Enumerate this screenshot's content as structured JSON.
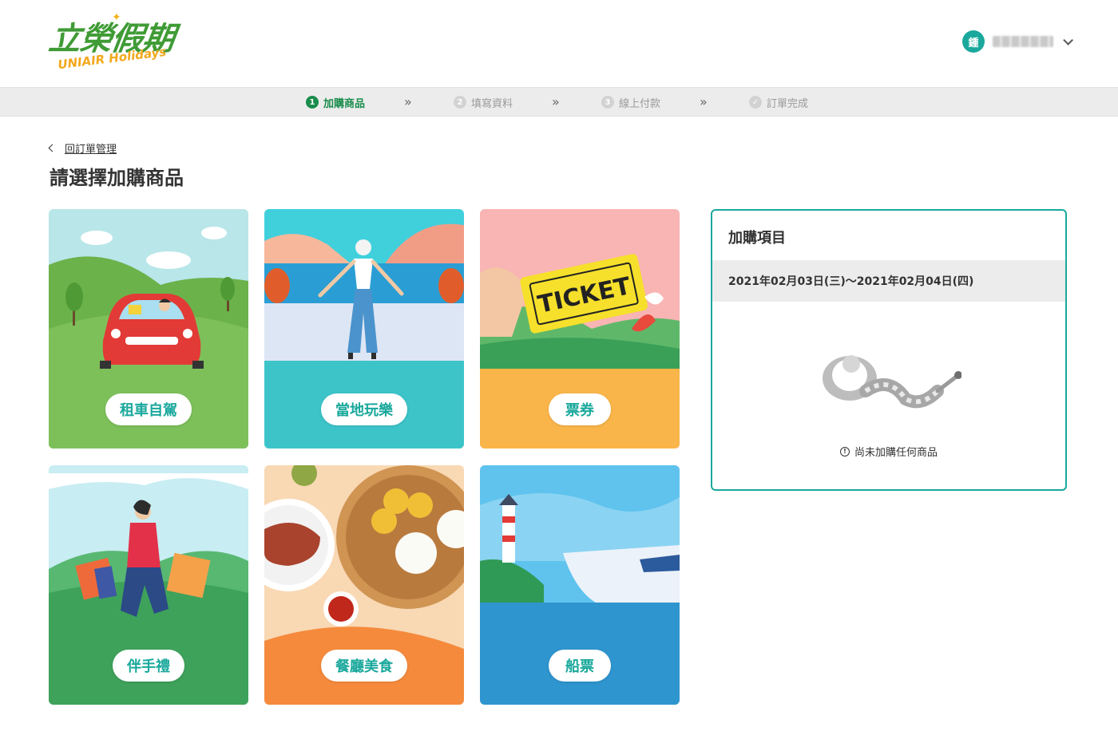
{
  "brand": {
    "name_cn": "立榮假期",
    "name_en": "UNIAIR Holidays",
    "colors": {
      "primary_green": "#3f9b35",
      "accent_orange": "#f2a81d",
      "teal": "#1aa89c"
    }
  },
  "user": {
    "avatar_initial": "鍾",
    "dropdown_icon": "chevron-down-icon"
  },
  "stepper": {
    "steps": [
      {
        "num": "1",
        "label": "加購商品",
        "active": true
      },
      {
        "num": "2",
        "label": "填寫資料",
        "active": false
      },
      {
        "num": "3",
        "label": "線上付款",
        "active": false
      },
      {
        "num": "✓",
        "label": "訂單完成",
        "active": false
      }
    ],
    "separator": "»"
  },
  "nav": {
    "back_label": "回訂單管理"
  },
  "page": {
    "title": "請選擇加購商品"
  },
  "categories": [
    {
      "label": "租車自駕",
      "illustration": "car-icon"
    },
    {
      "label": "當地玩樂",
      "illustration": "beach-icon"
    },
    {
      "label": "票券",
      "illustration": "ticket-icon"
    },
    {
      "label": "伴手禮",
      "illustration": "shopping-bag-icon"
    },
    {
      "label": "餐廳美食",
      "illustration": "food-icon"
    },
    {
      "label": "船票",
      "illustration": "ship-icon"
    }
  ],
  "summary": {
    "title": "加購項目",
    "date_range": "2021年02月03日(三)～2021年02月04日(四)",
    "empty_message": "尚未加購任何商品",
    "empty_icon": "info-icon"
  }
}
